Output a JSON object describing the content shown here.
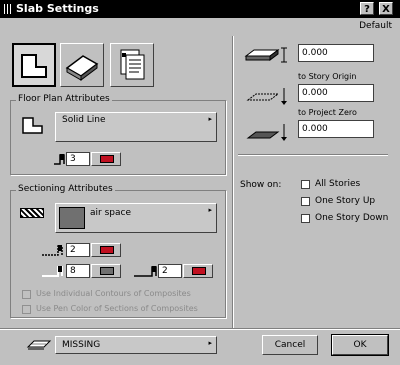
{
  "window": {
    "title": "Slab Settings",
    "help_label": "?",
    "close_label": "X",
    "default_label": "Default"
  },
  "tabs": [
    {
      "name": "floor-plan",
      "icon": "floor-plan-icon"
    },
    {
      "name": "model",
      "icon": "slab-3d-icon"
    },
    {
      "name": "listing",
      "icon": "listing-icon"
    }
  ],
  "floor_plan": {
    "label": "Floor Plan Attributes",
    "line_type": "Solid Line",
    "pen_value": "3"
  },
  "sectioning": {
    "label": "Sectioning Attributes",
    "material": "air space",
    "pen_top": "2",
    "pen_left": "8",
    "pen_right": "2",
    "check1_label": "Use Individual Contours of Composites",
    "check2_label": "Use Pen Color of Sections of Composites"
  },
  "geometry": {
    "thickness": "0.000",
    "offset_label": "to Story Origin",
    "offset": "0.000",
    "elevation_label": "to Project Zero",
    "elevation": "0.000"
  },
  "show_on": {
    "label": "Show on:",
    "options": [
      "All Stories",
      "One Story Up",
      "One Story Down"
    ]
  },
  "footer": {
    "layer": "MISSING",
    "cancel_label": "Cancel",
    "ok_label": "OK"
  },
  "colors": {
    "pen_red": "#c01020",
    "title_bg": "#000000",
    "dialog_bg": "#c0c0c0"
  }
}
